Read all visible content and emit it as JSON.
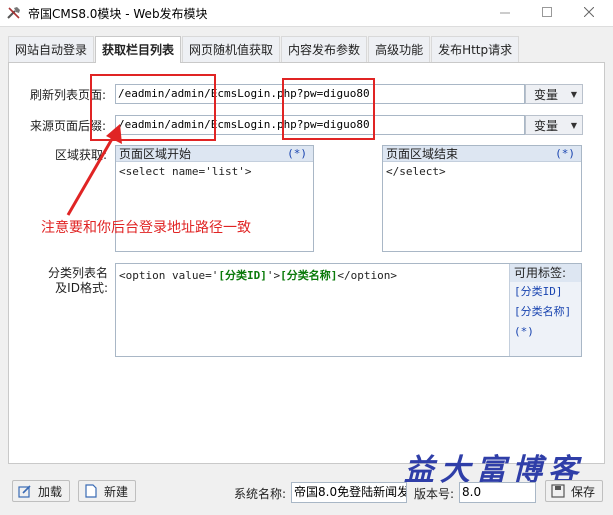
{
  "window": {
    "title": "帝国CMS8.0模块 - Web发布模块",
    "icon": "tools-icon",
    "buttons": [
      "minimize",
      "maximize",
      "close"
    ]
  },
  "tabs": [
    {
      "label": "网站自动登录",
      "active": false
    },
    {
      "label": "获取栏目列表",
      "active": true
    },
    {
      "label": "网页随机值获取",
      "active": false
    },
    {
      "label": "内容发布参数",
      "active": false
    },
    {
      "label": "高级功能",
      "active": false
    },
    {
      "label": "发布Http请求",
      "active": false
    }
  ],
  "form": {
    "refresh_label": "刷新列表页面:",
    "refresh_value": "/eadmin/admin/EcmsLogin.php?pw=diguo80",
    "source_label": "来源页面后缀:",
    "source_value": "/eadmin/admin/EcmsLogin.php?pw=diguo80",
    "var_button": "变量",
    "region_label": "区域获取:",
    "region_start_title": "页面区域开始",
    "region_start_value": "<select name='list'>",
    "region_end_title": "页面区域结束",
    "region_end_value": "</select>",
    "star_btn": "(*)",
    "category_label_line1": "分类列表名",
    "category_label_line2": "及ID格式:",
    "category_format": {
      "p1": "<option value='",
      "p2": "[分类ID]",
      "p3": "'>",
      "p4": "[分类名称]",
      "p5": "</option>"
    },
    "available_tags_title": "可用标签:",
    "available_tags": [
      "[分类ID]",
      "[分类名称]",
      "(*)"
    ]
  },
  "annotation": {
    "text": "注意要和你后台登录地址路径一致",
    "color": "#e02424"
  },
  "watermark": "益大富博客",
  "footer": {
    "load_button": "加载",
    "new_button": "新建",
    "system_name_label": "系统名称:",
    "system_name_value": "帝国8.0免登陆新闻发",
    "version_label": "版本号:",
    "version_value": "8.0",
    "save_button": "保存"
  }
}
